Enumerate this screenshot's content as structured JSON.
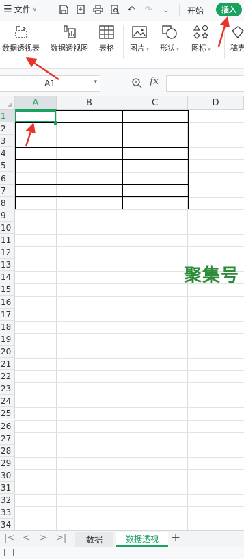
{
  "topbar": {
    "menu_label": "文件",
    "tabs": [
      "开始",
      "插入"
    ],
    "active_tab": "插入",
    "accent": "#1aa160"
  },
  "ribbon": {
    "items": [
      {
        "label": "数据透视表",
        "icon": "pivot-table-icon"
      },
      {
        "label": "数据透视图",
        "icon": "pivot-chart-icon"
      },
      {
        "label": "表格",
        "icon": "table-icon"
      },
      {
        "label": "图片",
        "icon": "picture-icon"
      },
      {
        "label": "形状",
        "icon": "shape-icon"
      },
      {
        "label": "图标",
        "icon": "icon-library-icon"
      },
      {
        "label": "稿壳",
        "icon": "template-icon"
      }
    ]
  },
  "formula_bar": {
    "cell_ref": "A1",
    "fx_label": "fx",
    "formula": ""
  },
  "grid": {
    "columns": [
      "A",
      "B",
      "C",
      "D"
    ],
    "rows": [
      "1",
      "2",
      "3",
      "4",
      "5",
      "6",
      "7",
      "8",
      "9",
      "10",
      "11",
      "12",
      "13",
      "14",
      "15",
      "16",
      "17",
      "18",
      "19",
      "20",
      "21",
      "22",
      "23",
      "24",
      "25",
      "26",
      "27",
      "28",
      "29",
      "30",
      "31",
      "32",
      "33",
      "34"
    ],
    "selected_cell": "A1",
    "watermark": "聚集号"
  },
  "sheets": {
    "tabs": [
      "数据",
      "数据透视"
    ],
    "active": "数据透视",
    "add_label": "+"
  }
}
